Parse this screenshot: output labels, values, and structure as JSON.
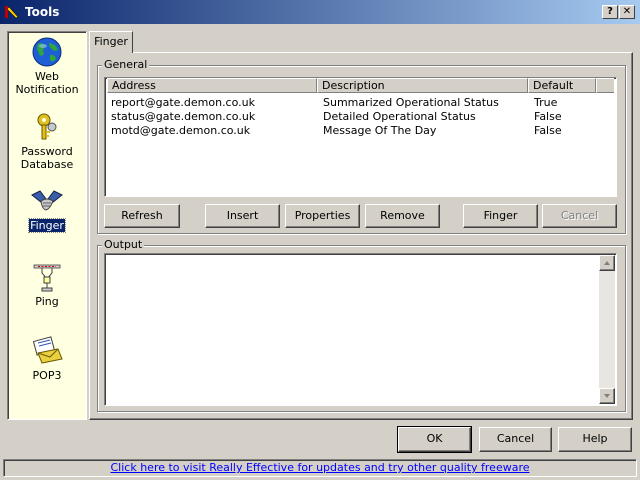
{
  "window": {
    "title": "Tools",
    "help_glyph": "?",
    "close_glyph": "✕"
  },
  "sidebar": {
    "items": [
      {
        "label_line1": "Web",
        "label_line2": "Notification",
        "icon": "globe-icon"
      },
      {
        "label_line1": "Password",
        "label_line2": "Database",
        "icon": "keys-icon"
      },
      {
        "label_line1": "Finger",
        "label_line2": "",
        "icon": "handshake-icon",
        "selected": true
      },
      {
        "label_line1": "Ping",
        "label_line2": "",
        "icon": "network-icon"
      },
      {
        "label_line1": "POP3",
        "label_line2": "",
        "icon": "mail-icon"
      }
    ]
  },
  "tab": {
    "label": "Finger"
  },
  "general": {
    "label": "General",
    "columns": [
      "Address",
      "Description",
      "Default"
    ],
    "rows": [
      [
        "report@gate.demon.co.uk",
        "Summarized Operational Status",
        "True"
      ],
      [
        "status@gate.demon.co.uk",
        "Detailed Operational Status",
        "False"
      ],
      [
        "motd@gate.demon.co.uk",
        "Message Of The Day",
        "False"
      ]
    ]
  },
  "buttons": {
    "refresh": "Refresh",
    "insert": "Insert",
    "properties": "Properties",
    "remove": "Remove",
    "finger": "Finger",
    "cancel": "Cancel"
  },
  "output": {
    "label": "Output",
    "text": ""
  },
  "footer": {
    "ok": "OK",
    "cancel": "Cancel",
    "help": "Help",
    "link": "Click here to visit Really Effective for updates and try other quality freeware"
  },
  "colors": {
    "title_start": "#0a246a",
    "title_end": "#a6caf0",
    "sidebar_bg": "#ffffe1",
    "link": "#0000ff",
    "face": "#d4d0c8"
  }
}
